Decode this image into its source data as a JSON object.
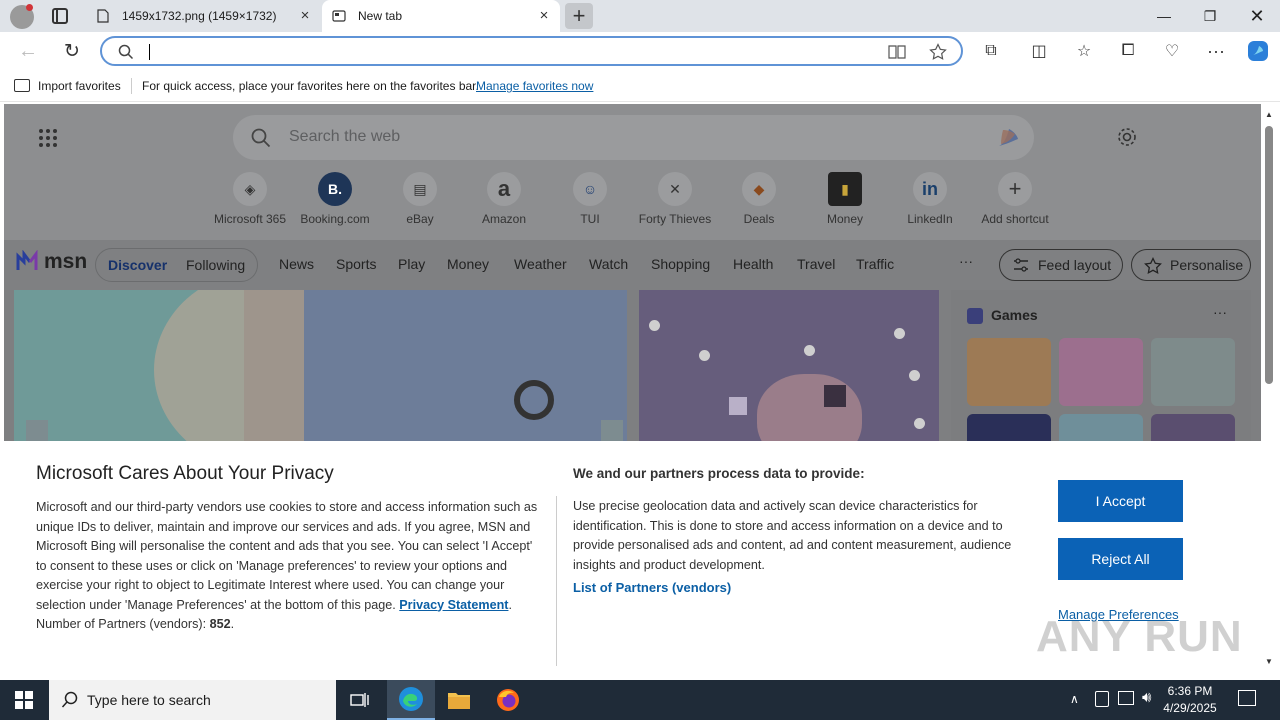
{
  "tabs": [
    {
      "title": "1459x1732.png (1459×1732)"
    },
    {
      "title": "New tab"
    }
  ],
  "favorites_bar": {
    "import_label": "Import favorites",
    "message": "For quick access, place your favorites here on the favorites bar.",
    "manage_link": "Manage favorites now"
  },
  "ntp": {
    "search_placeholder": "Search the web",
    "shortcuts": [
      {
        "label": "Microsoft 365",
        "glyph": "◈"
      },
      {
        "label": "Booking.com",
        "glyph": "B."
      },
      {
        "label": "eBay",
        "glyph": "▤"
      },
      {
        "label": "Amazon",
        "glyph": "a"
      },
      {
        "label": "TUI",
        "glyph": "☺"
      },
      {
        "label": "Forty Thieves",
        "glyph": "✕"
      },
      {
        "label": "Deals",
        "glyph": "◆"
      },
      {
        "label": "Money",
        "glyph": "▮"
      },
      {
        "label": "LinkedIn",
        "glyph": "in"
      },
      {
        "label": "Add shortcut",
        "glyph": "+"
      }
    ],
    "msn_logo": "msn",
    "nav": {
      "discover": "Discover",
      "following": "Following",
      "items": [
        "News",
        "Sports",
        "Play",
        "Money",
        "Weather",
        "Watch",
        "Shopping",
        "Health",
        "Travel",
        "Traffic"
      ],
      "more": "···",
      "feed_layout": "Feed layout",
      "personalise": "Personalise"
    },
    "games_title": "Games",
    "games_more": "···"
  },
  "privacy": {
    "title": "Microsoft Cares About Your Privacy",
    "body": "Microsoft and our third-party vendors use cookies to store and access information such as unique IDs to deliver, maintain and improve our services and ads. If you agree, MSN and Microsoft Bing will personalise the content and ads that you see. You can select 'I Accept' to consent to these uses or click on 'Manage preferences' to review your options and exercise your right to object to Legitimate Interest where used.  You can change your selection under 'Manage Preferences' at the bottom of this page.",
    "privacy_link": "Privacy Statement",
    "partners_label": "Number of Partners (vendors):",
    "partners_count": "852",
    "purposes_title": "We and our partners process data to provide:",
    "purposes_text": "Use precise geolocation data and actively scan device characteristics for identification. This is done to store and access information on a device and to provide personalised ads and content, ad and content measurement, audience insights and product development.",
    "partners_link": "List of Partners (vendors)",
    "accept": "I Accept",
    "reject": "Reject All",
    "manage": "Manage Preferences"
  },
  "taskbar": {
    "search_placeholder": "Type here to search",
    "time": "6:36 PM",
    "date": "4/29/2025"
  },
  "watermark": "ANY RUN",
  "colors": {
    "accent": "#0b62b6",
    "link": "#0b5fa5",
    "address_border": "#5f93d6",
    "taskbar": "#1f2b38"
  }
}
